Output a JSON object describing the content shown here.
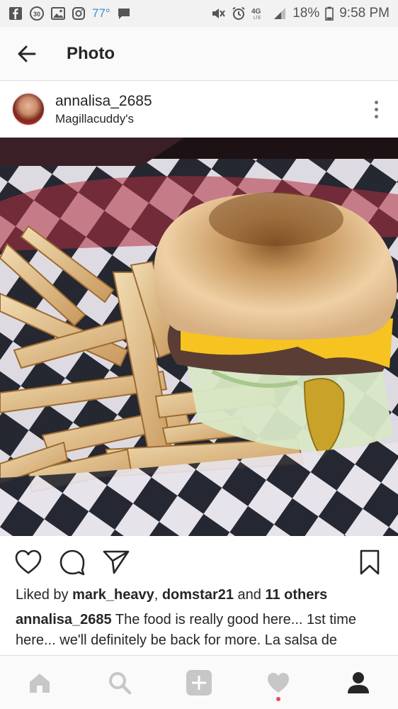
{
  "status_bar": {
    "temperature": "77°",
    "network": "4G",
    "network_sub": "LTE",
    "battery": "18%",
    "time": "9:58 PM"
  },
  "app_bar": {
    "title": "Photo"
  },
  "post": {
    "username": "annalisa_2685",
    "location": "Magillacuddy's",
    "likes_prefix": "Liked by ",
    "liker_1": "mark_heavy",
    "liker_sep": ", ",
    "liker_2": "domstar21",
    "likes_and": " and ",
    "likes_others": "11 others",
    "caption_user": "annalisa_2685",
    "caption_text": " The food is really good here... 1st time here... we'll definitely be back for more. La salsa de"
  },
  "colors": {
    "accent_temp": "#3b8ed8",
    "notification": "#ed4956"
  },
  "icons": {
    "back": "arrow-left-icon",
    "more": "more-vertical-icon",
    "like": "heart-icon",
    "comment": "comment-icon",
    "share": "send-icon",
    "save": "bookmark-icon",
    "nav": [
      "home-icon",
      "search-icon",
      "add-icon",
      "activity-icon",
      "profile-icon"
    ]
  }
}
